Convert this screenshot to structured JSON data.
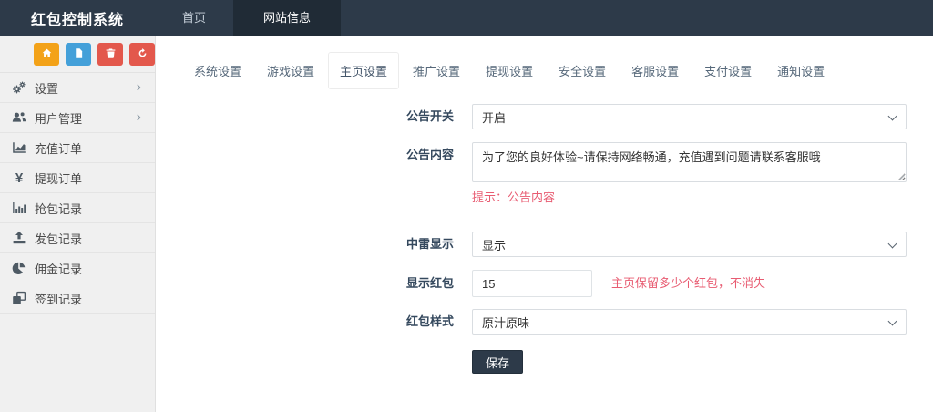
{
  "app": {
    "title": "红包控制系统"
  },
  "topnav": {
    "items": [
      {
        "label": "首页",
        "active": false
      },
      {
        "label": "网站信息",
        "active": true
      }
    ]
  },
  "sidebar": {
    "quick_buttons": [
      {
        "icon": "home-icon",
        "color": "#f3a218"
      },
      {
        "icon": "file-icon",
        "color": "#44a0d9"
      },
      {
        "icon": "trash-icon",
        "color": "#e3584c"
      },
      {
        "icon": "recycle-icon",
        "color": "#e3584c"
      }
    ],
    "submenu_chevron": "›",
    "yen_glyph": "¥",
    "items": [
      {
        "label": "设置",
        "icon": "gears-icon",
        "has_submenu": true
      },
      {
        "label": "用户管理",
        "icon": "users-icon",
        "has_submenu": true
      },
      {
        "label": "充值订单",
        "icon": "area-chart-icon",
        "has_submenu": false
      },
      {
        "label": "提现订单",
        "icon": "yen-icon",
        "has_submenu": false
      },
      {
        "label": "抢包记录",
        "icon": "bar-chart-icon",
        "has_submenu": false
      },
      {
        "label": "发包记录",
        "icon": "upload-icon",
        "has_submenu": false
      },
      {
        "label": "佣金记录",
        "icon": "pie-chart-icon",
        "has_submenu": false
      },
      {
        "label": "签到记录",
        "icon": "clone-icon",
        "has_submenu": false
      }
    ]
  },
  "tabs": {
    "active": "主页设置",
    "items": [
      "系统设置",
      "游戏设置",
      "主页设置",
      "推广设置",
      "提现设置",
      "安全设置",
      "客服设置",
      "支付设置",
      "通知设置"
    ]
  },
  "form": {
    "announcement_switch": {
      "label": "公告开关",
      "value": "开启"
    },
    "announcement_content": {
      "label": "公告内容",
      "value": "为了您的良好体验~请保持网络畅通，充值遇到问题请联系客服哦",
      "hint": "提示：公告内容"
    },
    "mine_display": {
      "label": "中雷显示",
      "value": "显示"
    },
    "show_redpacket": {
      "label": "显示红包",
      "value": "15",
      "hint": "主页保留多少个红包，不消失"
    },
    "redpacket_style": {
      "label": "红包样式",
      "value": "原汁原味"
    },
    "save_label": "保存"
  },
  "colors": {
    "header_bg": "#2d3a49",
    "header_active_bg": "#202b36",
    "sidebar_bg": "#f0f0f0",
    "accent_orange": "#f3a218",
    "accent_blue": "#44a0d9",
    "accent_red": "#e3584c",
    "hint_red": "#e85c72",
    "save_button_bg": "#2d3a49"
  }
}
